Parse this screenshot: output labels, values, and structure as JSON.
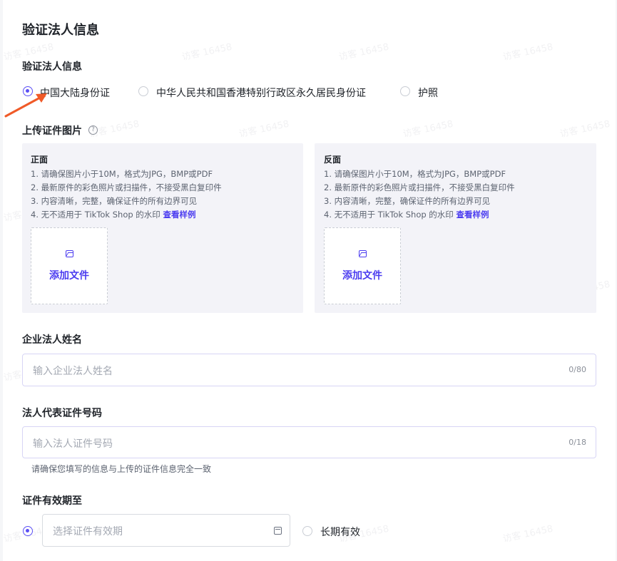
{
  "page_title": "验证法人信息",
  "id_type": {
    "label": "验证法人信息",
    "options": [
      {
        "label": "中国大陆身份证",
        "selected": true
      },
      {
        "label": "中华人民共和国香港特别行政区永久居民身份证",
        "selected": false
      },
      {
        "label": "护照",
        "selected": false
      }
    ]
  },
  "upload": {
    "label": "上传证件图片",
    "front": {
      "title": "正面",
      "rules": [
        "1. 请确保图片小于10M，格式为JPG，BMP或PDF",
        "2. 最新原件的彩色照片或扫描件，不接受黑白复印件",
        "3. 内容清晰，完整，确保证件的所有边界可见",
        "4. 无不适用于 TikTok Shop 的水印"
      ],
      "sample_link": "查看样例",
      "add_file": "添加文件"
    },
    "back": {
      "title": "反面",
      "rules": [
        "1. 请确保图片小于10M，格式为JPG，BMP或PDF",
        "2. 最新原件的彩色照片或扫描件，不接受黑白复印件",
        "3. 内容清晰，完整，确保证件的所有边界可见",
        "4. 无不适用于 TikTok Shop 的水印"
      ],
      "sample_link": "查看样例",
      "add_file": "添加文件"
    }
  },
  "legal_name": {
    "label": "企业法人姓名",
    "placeholder": "输入企业法人姓名",
    "counter": "0/80"
  },
  "id_number": {
    "label": "法人代表证件号码",
    "placeholder": "输入法人证件号码",
    "counter": "0/18",
    "hint": "请确保您填写的信息与上传的证件信息完全一致"
  },
  "expiry": {
    "label": "证件有效期至",
    "placeholder": "选择证件有效期",
    "long_term": "长期有效",
    "selected": "date"
  },
  "watermark_text": "访客 16458",
  "colors": {
    "accent": "#4b3cf0",
    "arrow": "#f05a28"
  }
}
